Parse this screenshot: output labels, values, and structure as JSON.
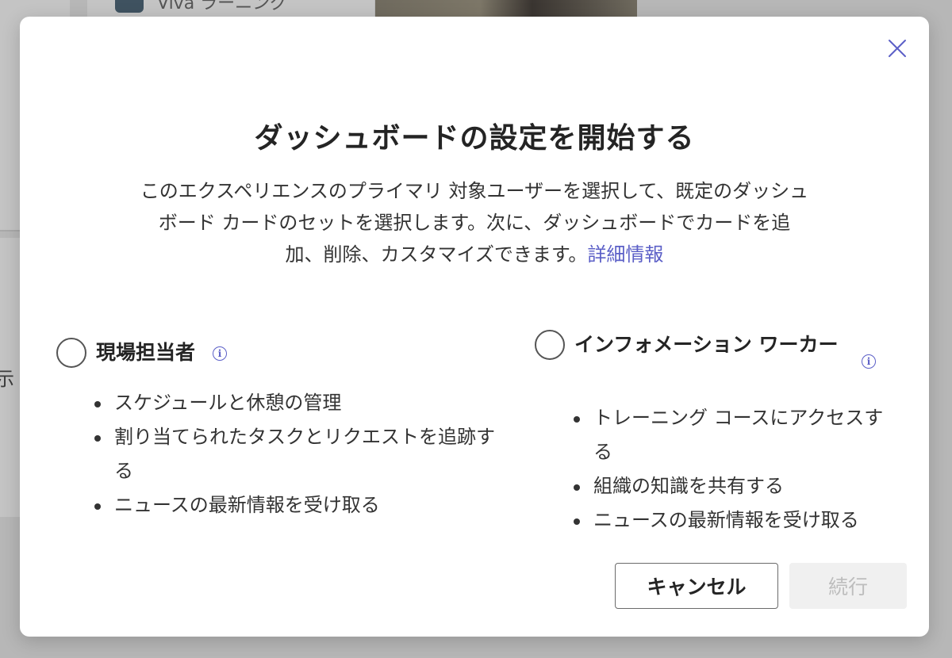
{
  "background": {
    "app_name": "Viva ラーニング",
    "side_text": "示"
  },
  "dialog": {
    "title": "ダッシュボードの設定を開始する",
    "description_lines": [
      "このエクスペリエンスのプライマリ 対象ユーザーを選択して、既定のダッシュ",
      "ボード カードのセットを選択します。次に、ダッシュボードでカードを追",
      "加、削除、カスタマイズできます。"
    ],
    "learn_more_link": "詳細情報",
    "options": [
      {
        "title": "現場担当者",
        "selected": false,
        "bullets": [
          "スケジュールと休憩の管理",
          "割り当てられたタスクとリクエストを追跡する",
          "ニュースの最新情報を受け取る"
        ]
      },
      {
        "title": "インフォメーション ワーカー",
        "selected": false,
        "bullets": [
          "トレーニング コースにアクセスする",
          "組織の知識を共有する",
          "ニュースの最新情報を受け取る"
        ]
      }
    ],
    "cancel_label": "キャンセル",
    "continue_label": "続行",
    "continue_enabled": false
  },
  "colors": {
    "accent": "#5b5fc7",
    "overlay": "#b7b7b7",
    "disabled_bg": "#f0f0f0"
  },
  "icons": [
    "close-icon",
    "info-icon",
    "radio-button"
  ]
}
